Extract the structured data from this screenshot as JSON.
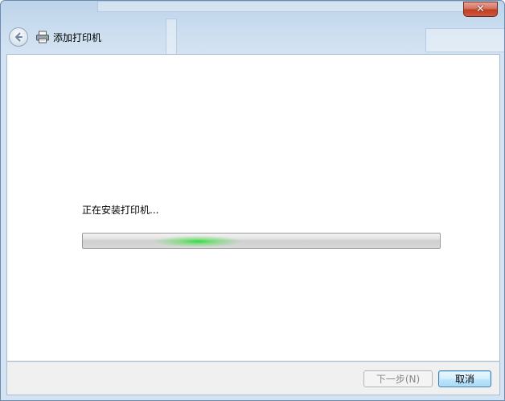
{
  "window": {
    "title": "添加打印机",
    "close_glyph": "✕"
  },
  "icons": {
    "back": "back-arrow-icon",
    "printer": "printer-icon",
    "close": "close-icon"
  },
  "content": {
    "status_text": "正在安装打印机...",
    "progress_mode": "indeterminate"
  },
  "footer": {
    "next_label": "下一步(N)",
    "cancel_label": "取消"
  },
  "colors": {
    "progress_glow": "#28dc3c",
    "close_button": "#c13d24",
    "frame": "#c9dcef"
  }
}
